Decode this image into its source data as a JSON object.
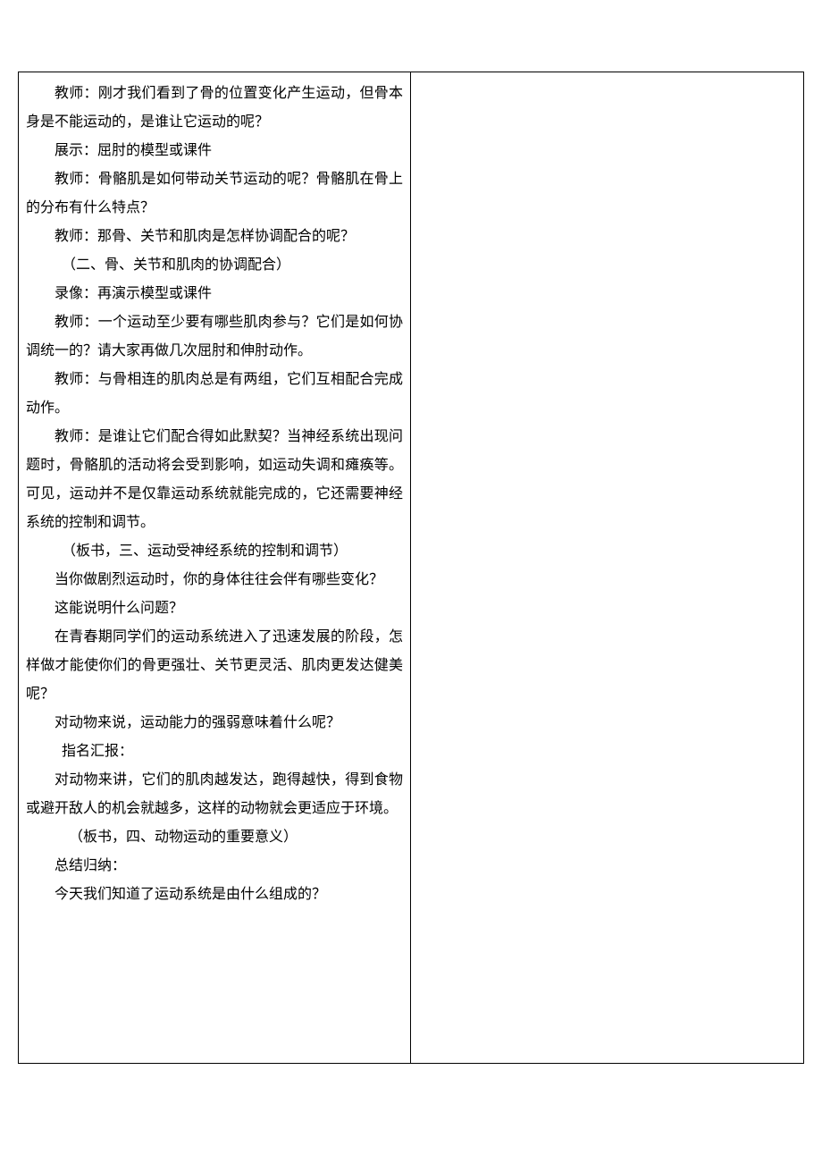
{
  "paragraphs": [
    {
      "class": "paragraph",
      "text": "教师：刚才我们看到了骨的位置变化产生运动，但骨本身是不能运动的，是谁让它运动的呢？"
    },
    {
      "class": "paragraph",
      "text": "展示：屈肘的模型或课件"
    },
    {
      "class": "paragraph",
      "text": "教师：骨骼肌是如何带动关节运动的呢？骨骼肌在骨上的分布有什么特点？"
    },
    {
      "class": "paragraph",
      "text": "教师：那骨、关节和肌肉是怎样协调配合的呢？"
    },
    {
      "class": "paragraph more-indent",
      "text": "（二、骨、关节和肌肉的协调配合）"
    },
    {
      "class": "paragraph",
      "text": "录像：再演示模型或课件"
    },
    {
      "class": "paragraph",
      "text": "教师：一个运动至少要有哪些肌肉参与？它们是如何协调统一的？请大家再做几次屈肘和伸肘动作。"
    },
    {
      "class": "paragraph",
      "text": "教师：与骨相连的肌肉总是有两组，它们互相配合完成动作。"
    },
    {
      "class": "paragraph",
      "text": "教师：是谁让它们配合得如此默契？当神经系统出现问题时，骨骼肌的活动将会受到影响，如运动失调和瘫痪等。可见，运动并不是仅靠运动系统就能完成的，它还需要神经系统的控制和调节。"
    },
    {
      "class": "paragraph more-indent",
      "text": "（板书，三、运动受神经系统的控制和调节）"
    },
    {
      "class": "paragraph",
      "text": "当你做剧烈运动时，你的身体往往会伴有哪些变化？"
    },
    {
      "class": "paragraph",
      "text": "这能说明什么问题？"
    },
    {
      "class": "paragraph",
      "text": "在青春期同学们的运动系统进入了迅速发展的阶段，怎样做才能使你们的骨更强壮、关节更灵活、肌肉更发达健美呢？"
    },
    {
      "class": "paragraph",
      "text": "对动物来说，运动能力的强弱意味着什么呢？"
    },
    {
      "class": "paragraph more-indent",
      "text": "指名汇报："
    },
    {
      "class": "paragraph",
      "text": "对动物来讲，它们的肌肉越发达，跑得越快，得到食物或避开敌人的机会就越多，这样的动物就会更适应于环境。"
    },
    {
      "class": "paragraph extra-indent",
      "text": "（板书，四、动物运动的重要意义）"
    },
    {
      "class": "paragraph",
      "text": "总结归纳："
    },
    {
      "class": "paragraph",
      "text": "今天我们知道了运动系统是由什么组成的？"
    }
  ]
}
